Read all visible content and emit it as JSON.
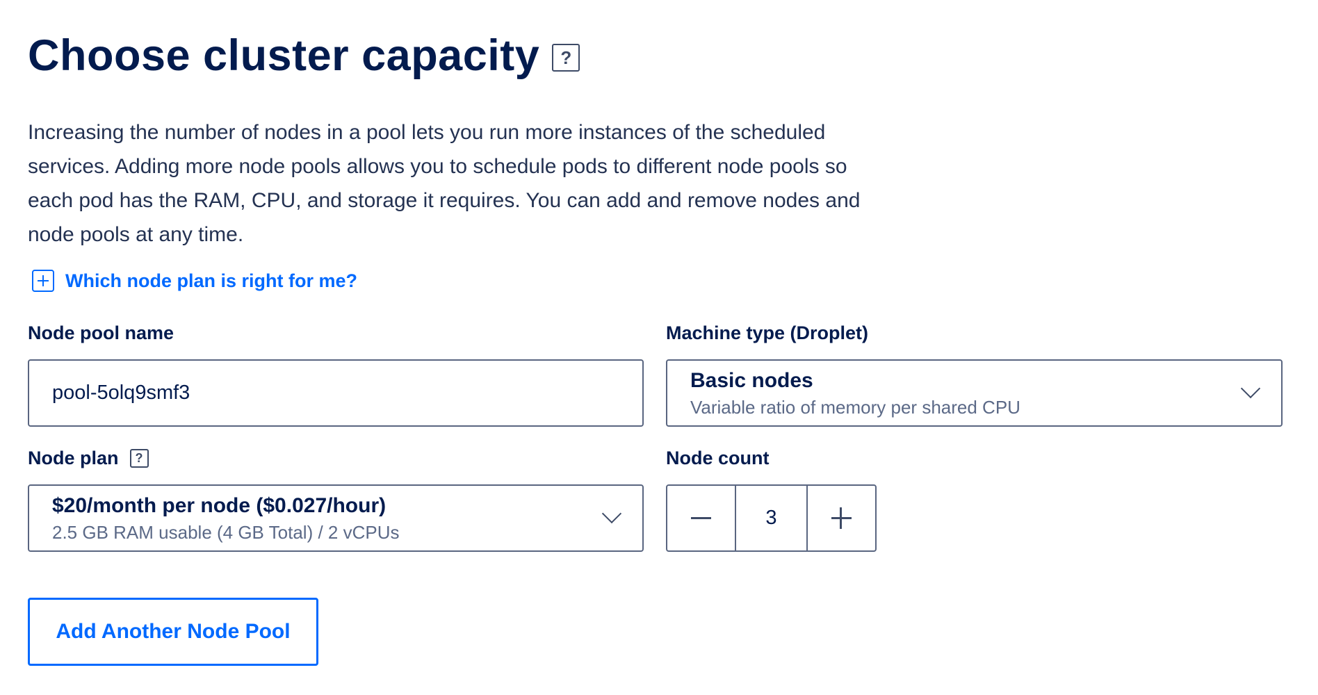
{
  "header": {
    "title": "Choose cluster capacity",
    "help_icon": "question-mark-icon"
  },
  "description": "Increasing the number of nodes in a pool lets you run more instances of the scheduled services. Adding more node pools allows you to schedule pods to different node pools so each pod has the RAM, CPU, and storage it requires. You can add and remove nodes and node pools at any time.",
  "expander": {
    "icon": "plus-box-icon",
    "label": "Which node plan is right for me?"
  },
  "node_pool_name": {
    "label": "Node pool name",
    "value": "pool-5olq9smf3"
  },
  "machine_type": {
    "label": "Machine type (Droplet)",
    "selected_title": "Basic nodes",
    "selected_subtitle": "Variable ratio of memory per shared CPU"
  },
  "node_plan": {
    "label": "Node plan",
    "selected_title": "$20/month per node ($0.027/hour)",
    "selected_subtitle": "2.5 GB RAM usable (4 GB Total) / 2 vCPUs"
  },
  "node_count": {
    "label": "Node count",
    "value": "3"
  },
  "actions": {
    "add_pool_label": "Add Another Node Pool"
  },
  "colors": {
    "accent": "#0069ff",
    "text_primary": "#031b4e",
    "border": "#596580"
  }
}
